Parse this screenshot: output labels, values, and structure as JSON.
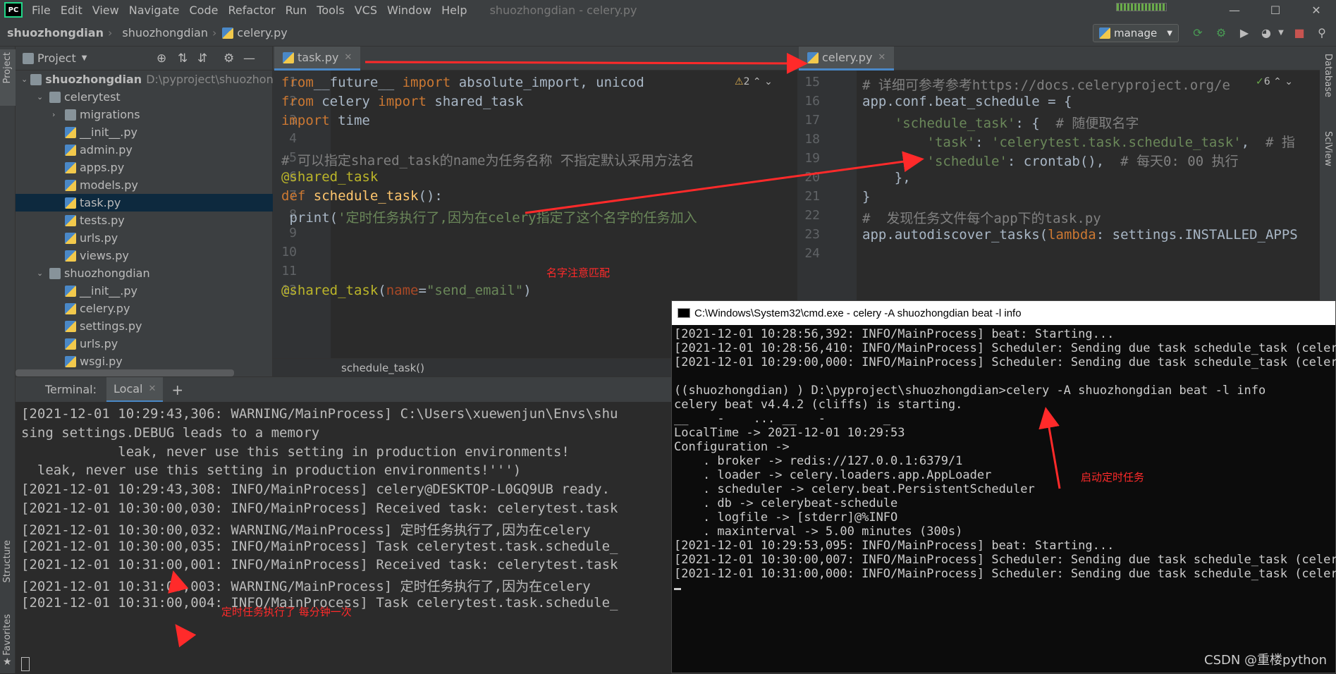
{
  "menubar": {
    "items": [
      "File",
      "Edit",
      "View",
      "Navigate",
      "Code",
      "Refactor",
      "Run",
      "Tools",
      "VCS",
      "Window",
      "Help"
    ],
    "title": "shuozhongdian - celery.py"
  },
  "navbar": {
    "crumbs": [
      "shuozhongdian",
      "shuozhongdian",
      "celery.py"
    ],
    "run_config": "manage"
  },
  "project": {
    "header": "Project",
    "tree": [
      {
        "label": "shuozhongdian",
        "extra": "D:\\pyproject\\shuozhongd",
        "type": "dir",
        "depth": 0,
        "open": true,
        "bold": true
      },
      {
        "label": "celerytest",
        "type": "dir",
        "depth": 1,
        "open": true
      },
      {
        "label": "migrations",
        "type": "dir",
        "depth": 2,
        "open": false
      },
      {
        "label": "__init__.py",
        "type": "file",
        "depth": 2
      },
      {
        "label": "admin.py",
        "type": "file",
        "depth": 2
      },
      {
        "label": "apps.py",
        "type": "file",
        "depth": 2
      },
      {
        "label": "models.py",
        "type": "file",
        "depth": 2
      },
      {
        "label": "task.py",
        "type": "file",
        "depth": 2,
        "selected": true
      },
      {
        "label": "tests.py",
        "type": "file",
        "depth": 2
      },
      {
        "label": "urls.py",
        "type": "file",
        "depth": 2
      },
      {
        "label": "views.py",
        "type": "file",
        "depth": 2
      },
      {
        "label": "shuozhongdian",
        "type": "dir",
        "depth": 1,
        "open": true
      },
      {
        "label": "__init__.py",
        "type": "file",
        "depth": 2
      },
      {
        "label": "celery.py",
        "type": "file",
        "depth": 2
      },
      {
        "label": "settings.py",
        "type": "file",
        "depth": 2
      },
      {
        "label": "urls.py",
        "type": "file",
        "depth": 2
      },
      {
        "label": "wsgi.py",
        "type": "file",
        "depth": 2
      }
    ]
  },
  "editor1": {
    "tab": "task.py",
    "warnings": "2",
    "breadcrumb": "schedule_task()",
    "line_numbers": [
      "1",
      "2",
      "3",
      "4",
      "5",
      "6",
      "7",
      "8",
      "9",
      "10",
      "11",
      "12"
    ],
    "lines": [
      [
        [
          "kw",
          "from"
        ],
        [
          "",
          "__future__ "
        ],
        [
          "kw",
          "import"
        ],
        [
          "",
          " absolute_import, unicod"
        ]
      ],
      [
        [
          "kw",
          "from"
        ],
        [
          "",
          " celery "
        ],
        [
          "kw",
          "import"
        ],
        [
          "",
          " shared_task"
        ]
      ],
      [
        [
          "kw",
          "import"
        ],
        [
          "",
          " time"
        ]
      ],
      [
        [
          "",
          ""
        ]
      ],
      [
        [
          "cm",
          "# 可以指定shared_task的name为任务名称 不指定默认采用方法名"
        ]
      ],
      [
        [
          "dec",
          "@shared_task"
        ]
      ],
      [
        [
          "kw",
          "def"
        ],
        [
          "",
          " "
        ],
        [
          "fn",
          "schedule_task"
        ],
        [
          "",
          "():"
        ]
      ],
      [
        [
          "",
          " print("
        ],
        [
          "str",
          "'定时任务执行了,因为在celery指定了这个名字的任务加入"
        ]
      ],
      [
        [
          "",
          ""
        ]
      ],
      [
        [
          "",
          ""
        ]
      ],
      [
        [
          "",
          ""
        ]
      ],
      [
        [
          "dec",
          "@shared_task"
        ],
        [
          "",
          "("
        ],
        [
          "prm",
          "name"
        ],
        [
          "",
          "="
        ],
        [
          "str",
          "\"send_email\""
        ],
        [
          "",
          ")"
        ]
      ]
    ]
  },
  "editor2": {
    "tab": "celery.py",
    "warnings": "6",
    "line_numbers": [
      "15",
      "16",
      "17",
      "18",
      "19",
      "20",
      "21",
      "22",
      "23",
      "24"
    ],
    "lines": [
      [
        [
          "cm",
          "# 详细可参考参考https://docs.celeryproject.org/e"
        ]
      ],
      [
        [
          "",
          "app.conf.beat_schedule = {"
        ]
      ],
      [
        [
          "str",
          "    'schedule_task'"
        ],
        [
          "",
          ": {  "
        ],
        [
          "cm",
          "# 随便取名字"
        ]
      ],
      [
        [
          "str",
          "        'task'"
        ],
        [
          "",
          ": "
        ],
        [
          "str",
          "'celerytest.task.schedule_task'"
        ],
        [
          "",
          ",  "
        ],
        [
          "cm",
          "# 指"
        ]
      ],
      [
        [
          "str",
          "        'schedule'"
        ],
        [
          "",
          ": crontab(),  "
        ],
        [
          "cm",
          "# 每天0: 00 执行"
        ]
      ],
      [
        [
          "",
          "    },"
        ]
      ],
      [
        [
          "",
          "}"
        ]
      ],
      [
        [
          "cm",
          "#  发现任务文件每个app下的task.py"
        ]
      ],
      [
        [
          "",
          "app.autodiscover_tasks("
        ],
        [
          "kw",
          "lambda"
        ],
        [
          "",
          ": settings.INSTALLED_APPS"
        ]
      ],
      [
        [
          "",
          ""
        ]
      ]
    ]
  },
  "terminal": {
    "label": "Terminal:",
    "tab": "Local",
    "lines": [
      "[2021-12-01 10:29:43,306: WARNING/MainProcess] C:\\Users\\xuewenjun\\Envs\\shu",
      "sing settings.DEBUG leads to a memory",
      "            leak, never use this setting in production environments!",
      "  leak, never use this setting in production environments!''')",
      "[2021-12-01 10:29:43,308: INFO/MainProcess] celery@DESKTOP-L0GQ9UB ready.",
      "[2021-12-01 10:30:00,030: INFO/MainProcess] Received task: celerytest.task",
      "[2021-12-01 10:30:00,032: WARNING/MainProcess] 定时任务执行了,因为在celery",
      "[2021-12-01 10:30:00,035: INFO/MainProcess] Task celerytest.task.schedule_",
      "[2021-12-01 10:31:00,001: INFO/MainProcess] Received task: celerytest.task",
      "[2021-12-01 10:31:00,003: WARNING/MainProcess] 定时任务执行了,因为在celery",
      "[2021-12-01 10:31:00,004: INFO/MainProcess] Task celerytest.task.schedule_"
    ]
  },
  "cmd": {
    "title": "C:\\Windows\\System32\\cmd.exe - celery  -A shuozhongdian beat -l info",
    "lines": [
      "[2021-12-01 10:28:56,392: INFO/MainProcess] beat: Starting...",
      "[2021-12-01 10:28:56,410: INFO/MainProcess] Scheduler: Sending due task schedule_task (celeryte",
      "[2021-12-01 10:29:00,000: INFO/MainProcess] Scheduler: Sending due task schedule_task (celeryte",
      "",
      "((shuozhongdian) ) D:\\pyproject\\shuozhongdian>celery -A shuozhongdian beat -l info",
      "celery beat v4.4.2 (cliffs) is starting.",
      "__    -    ... __   -        _",
      "LocalTime -> 2021-12-01 10:29:53",
      "Configuration ->",
      "    . broker -> redis://127.0.0.1:6379/1",
      "    . loader -> celery.loaders.app.AppLoader",
      "    . scheduler -> celery.beat.PersistentScheduler",
      "    . db -> celerybeat-schedule",
      "    . logfile -> [stderr]@%INFO",
      "    . maxinterval -> 5.00 minutes (300s)",
      "[2021-12-01 10:29:53,095: INFO/MainProcess] beat: Starting...",
      "[2021-12-01 10:30:00,007: INFO/MainProcess] Scheduler: Sending due task schedule_task (celeryte",
      "[2021-12-01 10:31:00,000: INFO/MainProcess] Scheduler: Sending due task schedule_task (celeryte"
    ]
  },
  "annotations": {
    "name_match": "名字注意匹配",
    "start_task": "启动定时任务",
    "every_minute": "定时任务执行了 每分钟一次"
  },
  "side_tools": {
    "left": [
      "Project",
      "Structure",
      "Favorites"
    ],
    "right": [
      "Database",
      "SciView"
    ]
  },
  "watermark": "CSDN @重楼python"
}
